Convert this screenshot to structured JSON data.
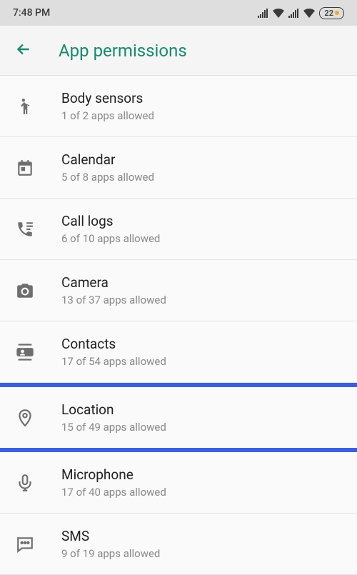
{
  "status": {
    "time": "7:48 PM",
    "battery": "22"
  },
  "header": {
    "title": "App permissions"
  },
  "items": [
    {
      "title": "Body sensors",
      "subtitle": "1 of 2 apps allowed"
    },
    {
      "title": "Calendar",
      "subtitle": "5 of 8 apps allowed"
    },
    {
      "title": "Call logs",
      "subtitle": "6 of 10 apps allowed"
    },
    {
      "title": "Camera",
      "subtitle": "13 of 37 apps allowed"
    },
    {
      "title": "Contacts",
      "subtitle": "17 of 54 apps allowed"
    },
    {
      "title": "Location",
      "subtitle": "15 of 49 apps allowed"
    },
    {
      "title": "Microphone",
      "subtitle": "17 of 40 apps allowed"
    },
    {
      "title": "SMS",
      "subtitle": "9 of 19 apps allowed"
    }
  ]
}
